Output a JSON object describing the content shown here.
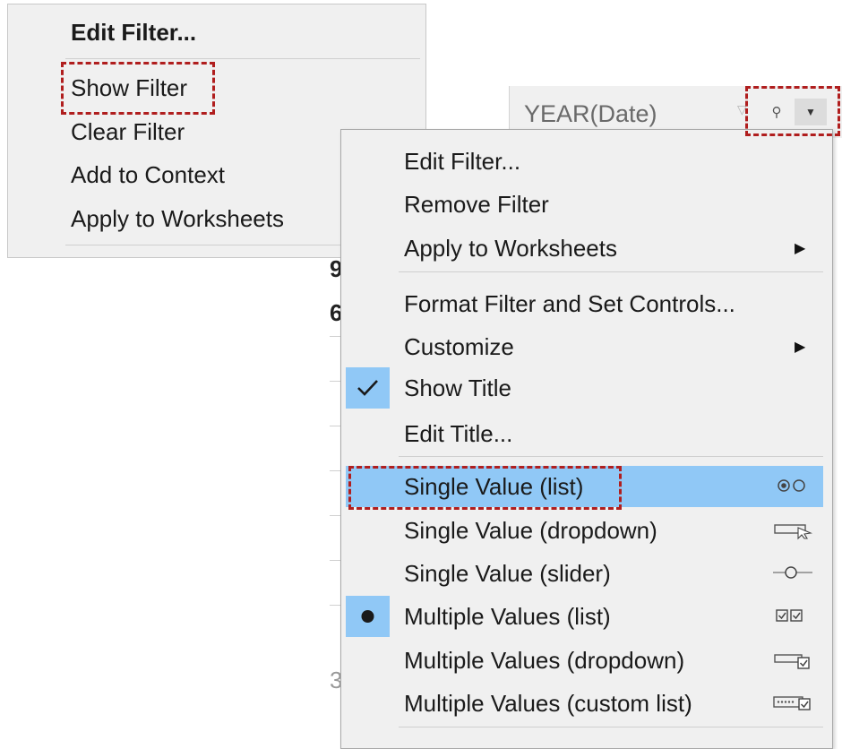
{
  "left_menu": {
    "items": [
      {
        "label": "Edit Filter...",
        "bold": true
      },
      {
        "label": "Show Filter"
      },
      {
        "label": "Clear Filter"
      },
      {
        "label": "Add to Context"
      },
      {
        "label": "Apply to Worksheets"
      }
    ]
  },
  "filter_card": {
    "title": "YEAR(Date)"
  },
  "background_fragments": [
    "9",
    "6",
    "3"
  ],
  "right_menu": {
    "items": [
      {
        "label": "Edit Filter..."
      },
      {
        "label": "Remove Filter"
      },
      {
        "label": "Apply to Worksheets",
        "submenu": true
      },
      {
        "label": "Format Filter and Set Controls..."
      },
      {
        "label": "Customize",
        "submenu": true
      },
      {
        "label": "Show Title",
        "checked": true
      },
      {
        "label": "Edit Title..."
      },
      {
        "label": "Single Value (list)",
        "highlighted": true,
        "icon": "radio-list-icon"
      },
      {
        "label": "Single Value (dropdown)",
        "icon": "dropdown-control-icon"
      },
      {
        "label": "Single Value (slider)",
        "icon": "slider-control-icon"
      },
      {
        "label": "Multiple Values (list)",
        "selected": true,
        "icon": "checkbox-list-icon"
      },
      {
        "label": "Multiple Values (dropdown)",
        "icon": "multi-dropdown-icon"
      },
      {
        "label": "Multiple Values (custom list)",
        "icon": "custom-list-icon"
      }
    ]
  },
  "colors": {
    "menu_bg": "#f0f0f0",
    "highlight": "#90c8f6",
    "callout": "#b01e1e"
  }
}
